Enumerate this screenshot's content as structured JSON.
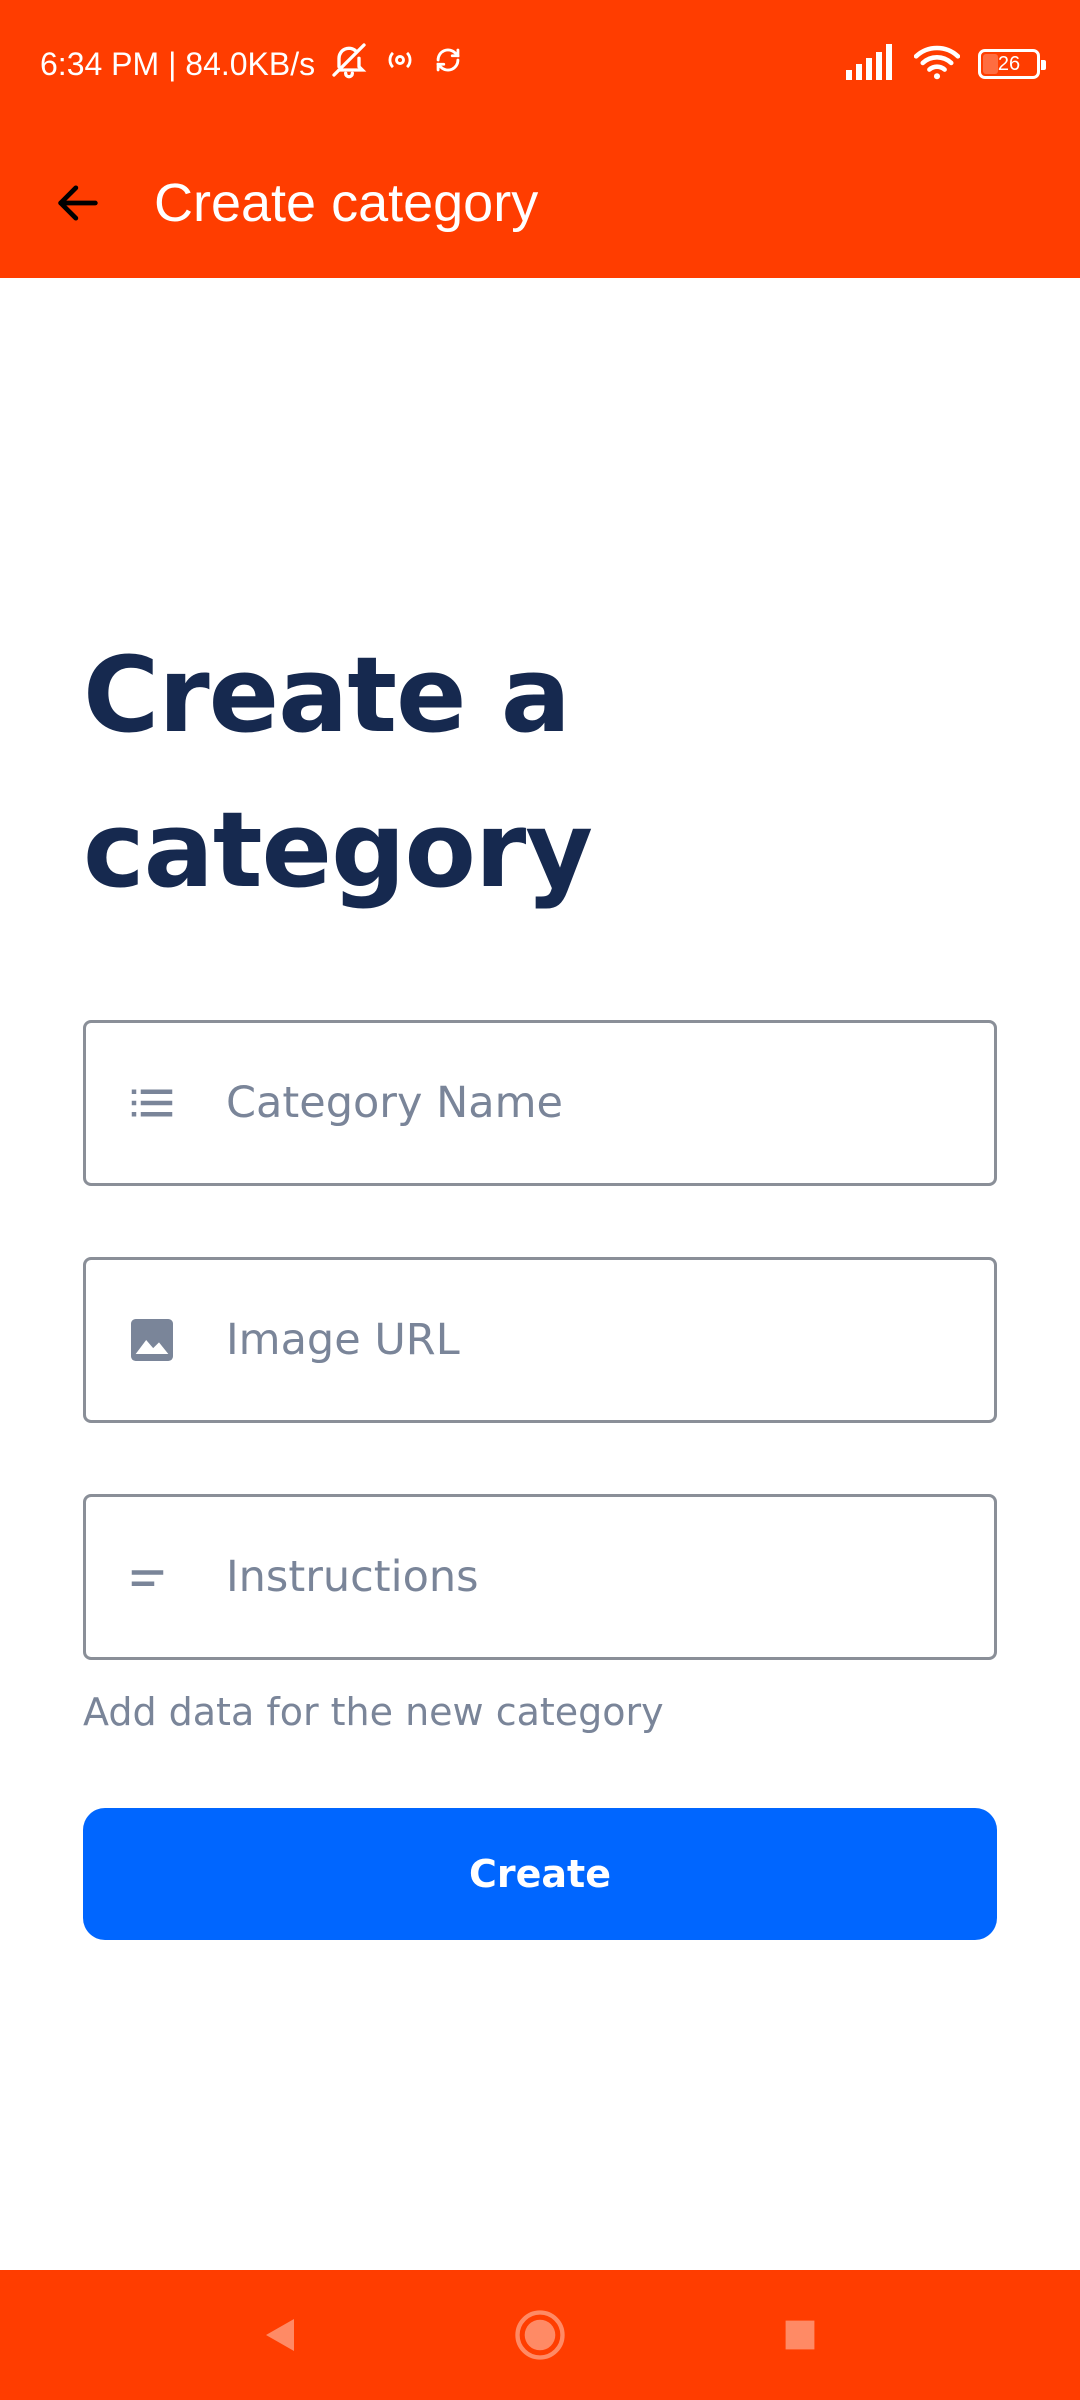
{
  "status_bar": {
    "time_info": "6:34 PM | 84.0KB/s",
    "battery": "26",
    "battery_level": 0.26,
    "icons": [
      "bell-off-icon",
      "hotspot-icon",
      "sync-icon",
      "signal-icon",
      "wifi-icon",
      "battery-icon"
    ]
  },
  "app_bar": {
    "title": "Create category",
    "back_icon": "arrow-left-icon"
  },
  "main": {
    "heading": "Create a category",
    "fields": [
      {
        "icon": "list-icon",
        "placeholder": "Category Name",
        "value": ""
      },
      {
        "icon": "image-icon",
        "placeholder": "Image URL",
        "value": ""
      },
      {
        "icon": "notes-icon",
        "placeholder": "Instructions",
        "value": ""
      }
    ],
    "helper_text": "Add data for the new category",
    "create_label": "Create"
  },
  "nav_bar": {
    "icons": [
      "back-triangle-icon",
      "home-circle-icon",
      "recents-square-icon"
    ]
  },
  "colors": {
    "accent": "#FF3D00",
    "primary_button": "#0066FF",
    "heading": "#16294F",
    "muted": "#7A8599"
  }
}
